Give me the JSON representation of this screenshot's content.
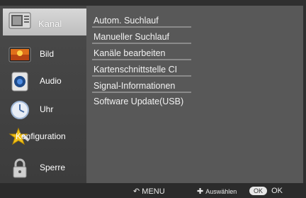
{
  "sidebar": {
    "items": [
      {
        "label": "Kanal",
        "icon": "tv-channel-icon",
        "active": true
      },
      {
        "label": "Bild",
        "icon": "picture-icon"
      },
      {
        "label": "Audio",
        "icon": "speaker-icon"
      },
      {
        "label": "Uhr",
        "icon": "clock-icon"
      },
      {
        "label": "Konfiguration",
        "icon": "star-config-icon"
      },
      {
        "label": "Sperre",
        "icon": "lock-icon"
      }
    ]
  },
  "menu": {
    "items": [
      "Autom. Suchlauf",
      "Manueller Suchlauf",
      "Kanäle bearbeiten",
      "Kartenschnittstelle CI",
      "Signal-Informationen",
      "Software Update(USB)"
    ]
  },
  "footer": {
    "menu_label": "MENU",
    "select_label": "Auswählen",
    "ok_pill": "OK",
    "ok_label": "OK"
  },
  "colors": {
    "active_bg": "#cfcfcf",
    "panel_bg": "#585858",
    "sidebar_bg": "#444444"
  }
}
